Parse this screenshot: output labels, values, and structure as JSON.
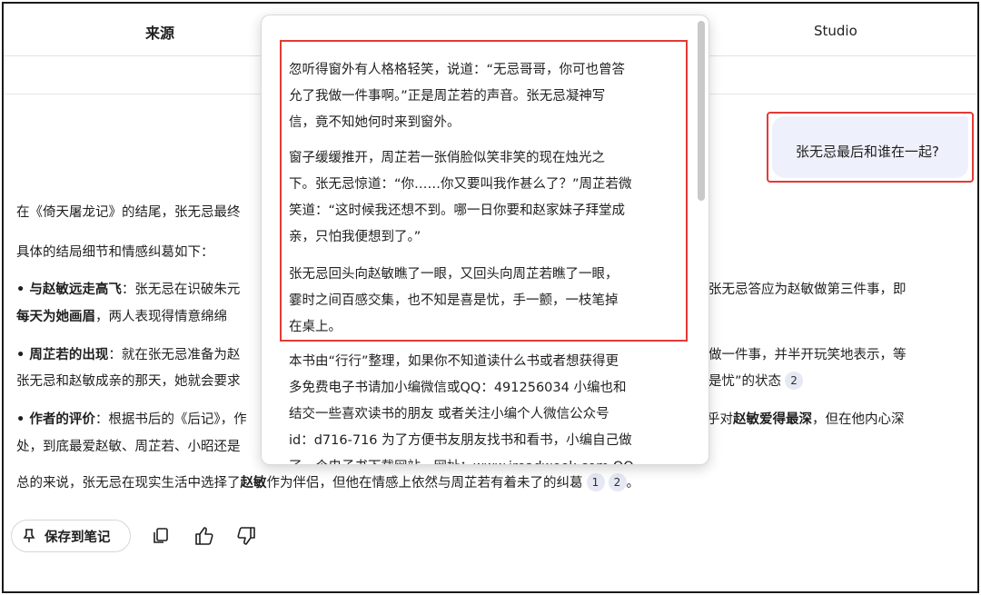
{
  "header": {
    "tab_sources": "来源",
    "tab_studio": "Studio"
  },
  "user_message": "张无忌最后和谁在一起?",
  "answer": {
    "line1": "在《倚天屠龙记》的结尾，张无忌最终",
    "line2": "具体的结局细节和情感纠葛如下：",
    "b1_label": "• 与赵敏远走高飞",
    "b1_text": "：张无忌在识破朱元",
    "b1_right": "张无忌答应为赵敏做第三件事，即",
    "b1_l2_bold": "每天为她画眉",
    "b1_l2_text": "，两人表现得情意绵绵",
    "b2_label": "• 周芷若的出现",
    "b2_text": "：就在张无忌准备为赵",
    "b2_right": "做一件事，并半开玩笑地表示，等",
    "b2_l2_text": "张无忌和赵敏成亲的那天，她就会要求",
    "b2_l2_right": "是忧”的状态",
    "b2_cite": "2",
    "b3_label": "• 作者的评价",
    "b3_text": "：根据书后的《后记》，作",
    "b3_right_pre": "乎对",
    "b3_right_bold": "赵敏爱得最深",
    "b3_right_post": "，但在他内心深",
    "b3_l2_text": "处，到底最爱赵敏、周芷若、小昭还是",
    "summary_pre": "总的来说，张无忌在现实生活中选择了",
    "summary_bold": "赵敏",
    "summary_post": "作为伴侣，但他在情感上依然与周芷若有着未了的纠葛",
    "summary_cite1": "1",
    "summary_cite2": "2"
  },
  "actions": {
    "save_label": "保存到笔记"
  },
  "popup": {
    "lines": [
      "忽听得窗外有人格格轻笑，说道：“无忌哥哥，你可也曾答",
      "允了我做一件事啊。”正是周芷若的声音。张无忌凝神写",
      "信，竟不知她何时来到窗外。",
      "窗子缓缓推开，周芷若一张俏脸似笑非笑的现在烛光之",
      "下。张无忌惊道：“你……你又要叫我作甚么了？”周芷若微",
      "笑道：“这时候我还想不到。哪一日你要和赵家妹子拜堂成",
      "亲，只怕我便想到了。”",
      "张无忌回头向赵敏瞧了一眼，又回头向周芷若瞧了一眼，",
      "霎时之间百感交集，也不知是喜是忧，手一颤，一枝笔掉",
      "在桌上。",
      "本书由“行行”整理，如果你不知道读什么书或者想获得更",
      "多免费电子书请加小编微信或QQ：491256034 小编也和",
      "结交一些喜欢读书的朋友 或者关注小编个人微信公众号",
      "id：d716-716 为了方便书友朋友找书和看书，小编自己做",
      "了一个电子书下载网站，网址：www.ireadweek.com QQ"
    ]
  },
  "colors": {
    "highlight": "#e53935",
    "bubble": "#eef0fb",
    "cite_bg": "#e6e8f4"
  }
}
